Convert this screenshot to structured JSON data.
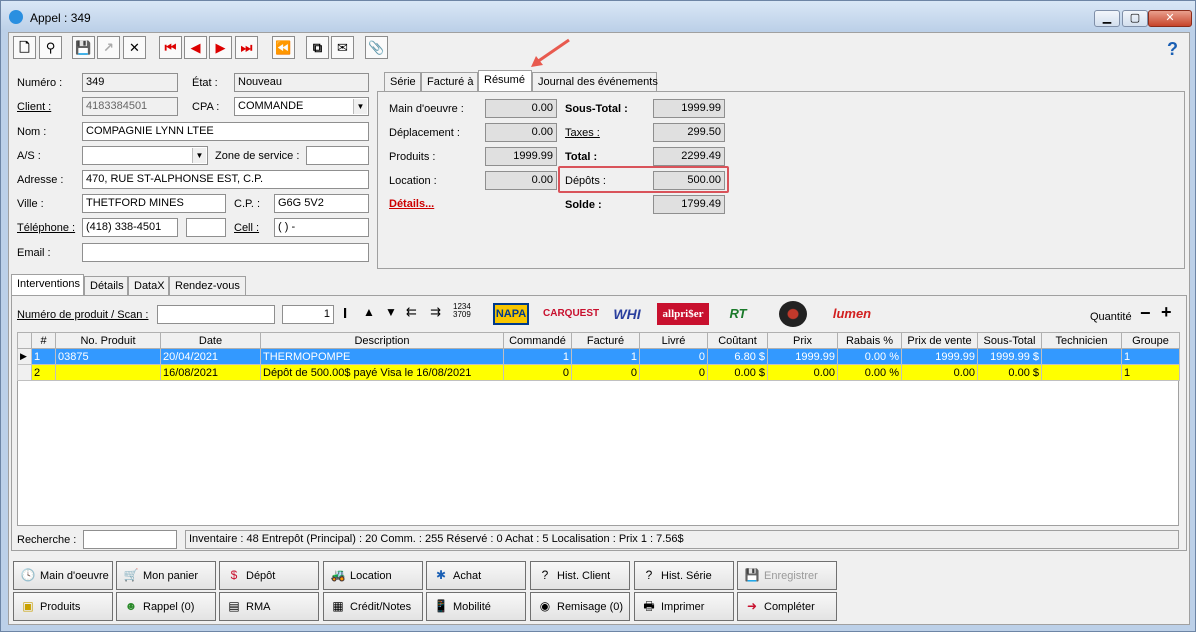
{
  "window": {
    "title": "Appel : 349"
  },
  "help": "?",
  "form": {
    "numero": {
      "label": "Numéro :",
      "value": "349"
    },
    "etat": {
      "label": "État :",
      "value": "Nouveau"
    },
    "client": {
      "label": "Client :",
      "value": "4183384501"
    },
    "cpa": {
      "label": "CPA :",
      "value": "COMMANDE"
    },
    "nom": {
      "label": "Nom :",
      "value": "COMPAGNIE LYNN LTEE"
    },
    "as": {
      "label": "A/S :",
      "value": ""
    },
    "zone": {
      "label": "Zone de service :",
      "value": ""
    },
    "adresse": {
      "label": "Adresse :",
      "value": "470, RUE ST-ALPHONSE EST, C.P."
    },
    "ville": {
      "label": "Ville :",
      "value": "THETFORD MINES"
    },
    "cp": {
      "label": "C.P. :",
      "value": "G6G 5V2"
    },
    "telephone": {
      "label": "Téléphone :",
      "value": "(418) 338-4501",
      "ext": ""
    },
    "cell": {
      "label": "Cell :",
      "value": "(  )    -"
    },
    "email": {
      "label": "Email :",
      "value": ""
    }
  },
  "summary_tabs": [
    "Série",
    "Facturé à",
    "Résumé",
    "Journal des événements"
  ],
  "summary": {
    "main_oeuvre": {
      "label": "Main d'oeuvre :",
      "value": "0.00"
    },
    "deplacement": {
      "label": "Déplacement :",
      "value": "0.00"
    },
    "produits": {
      "label": "Produits :",
      "value": "1999.99"
    },
    "location": {
      "label": "Location :",
      "value": "0.00"
    },
    "details": "Détails...",
    "sous_total": {
      "label": "Sous-Total :",
      "value": "1999.99"
    },
    "taxes": {
      "label": "Taxes :",
      "value": "299.50"
    },
    "total": {
      "label": "Total :",
      "value": "2299.49"
    },
    "depots": {
      "label": "Dépôts :",
      "value": "500.00"
    },
    "solde": {
      "label": "Solde :",
      "value": "1799.49"
    }
  },
  "lower_tabs": [
    "Interventions",
    "Détails",
    "DataX",
    "Rendez-vous"
  ],
  "product": {
    "label": "Numéro de produit / Scan :",
    "scan": "",
    "qty": "1",
    "quantite_label": "Quantité"
  },
  "suppliers": [
    "NAPA",
    "CARQUEST",
    "WHI",
    "allpri$er",
    "RT",
    "",
    "lumen"
  ],
  "grid": {
    "headers": [
      "",
      "#",
      "No. Produit",
      "Date",
      "Description",
      "Commandé",
      "Facturé",
      "Livré",
      "Coûtant",
      "Prix",
      "Rabais %",
      "Prix de vente",
      "Sous-Total",
      "Technicien",
      "Groupe"
    ],
    "rows": [
      [
        "▶",
        "1",
        "03875",
        "20/04/2021",
        "THERMOPOMPE",
        "1",
        "1",
        "0",
        "6.80 $",
        "1999.99",
        "0.00 %",
        "1999.99",
        "1999.99 $",
        "",
        "1"
      ],
      [
        "",
        "2",
        "",
        "16/08/2021",
        "Dépôt de 500.00$ payé Visa le 16/08/2021",
        "0",
        "0",
        "0",
        "0.00 $",
        "0.00",
        "0.00 %",
        "0.00",
        "0.00 $",
        "",
        "1"
      ]
    ]
  },
  "search": {
    "label": "Recherche :",
    "value": ""
  },
  "status": "Inventaire : 48  Entrepôt (Principal) : 20  Comm. : 255  Réservé : 0  Achat : 5  Localisation :    Prix 1 : 7.56$",
  "buttons_row1": [
    "Main d'oeuvre",
    "Mon panier",
    "Dépôt",
    "Location",
    "Achat",
    "Hist. Client",
    "Hist. Série",
    "Enregistrer"
  ],
  "buttons_row2": [
    "Produits",
    "Rappel (0)",
    "RMA",
    "Crédit/Notes",
    "Mobilité",
    "Remisage (0)",
    "Imprimer",
    "Compléter"
  ],
  "colors": {
    "selected_row": "#3399ff",
    "deposit_row": "#ffff00",
    "highlight": "#d9535a",
    "arrow": "#e85a4f"
  }
}
